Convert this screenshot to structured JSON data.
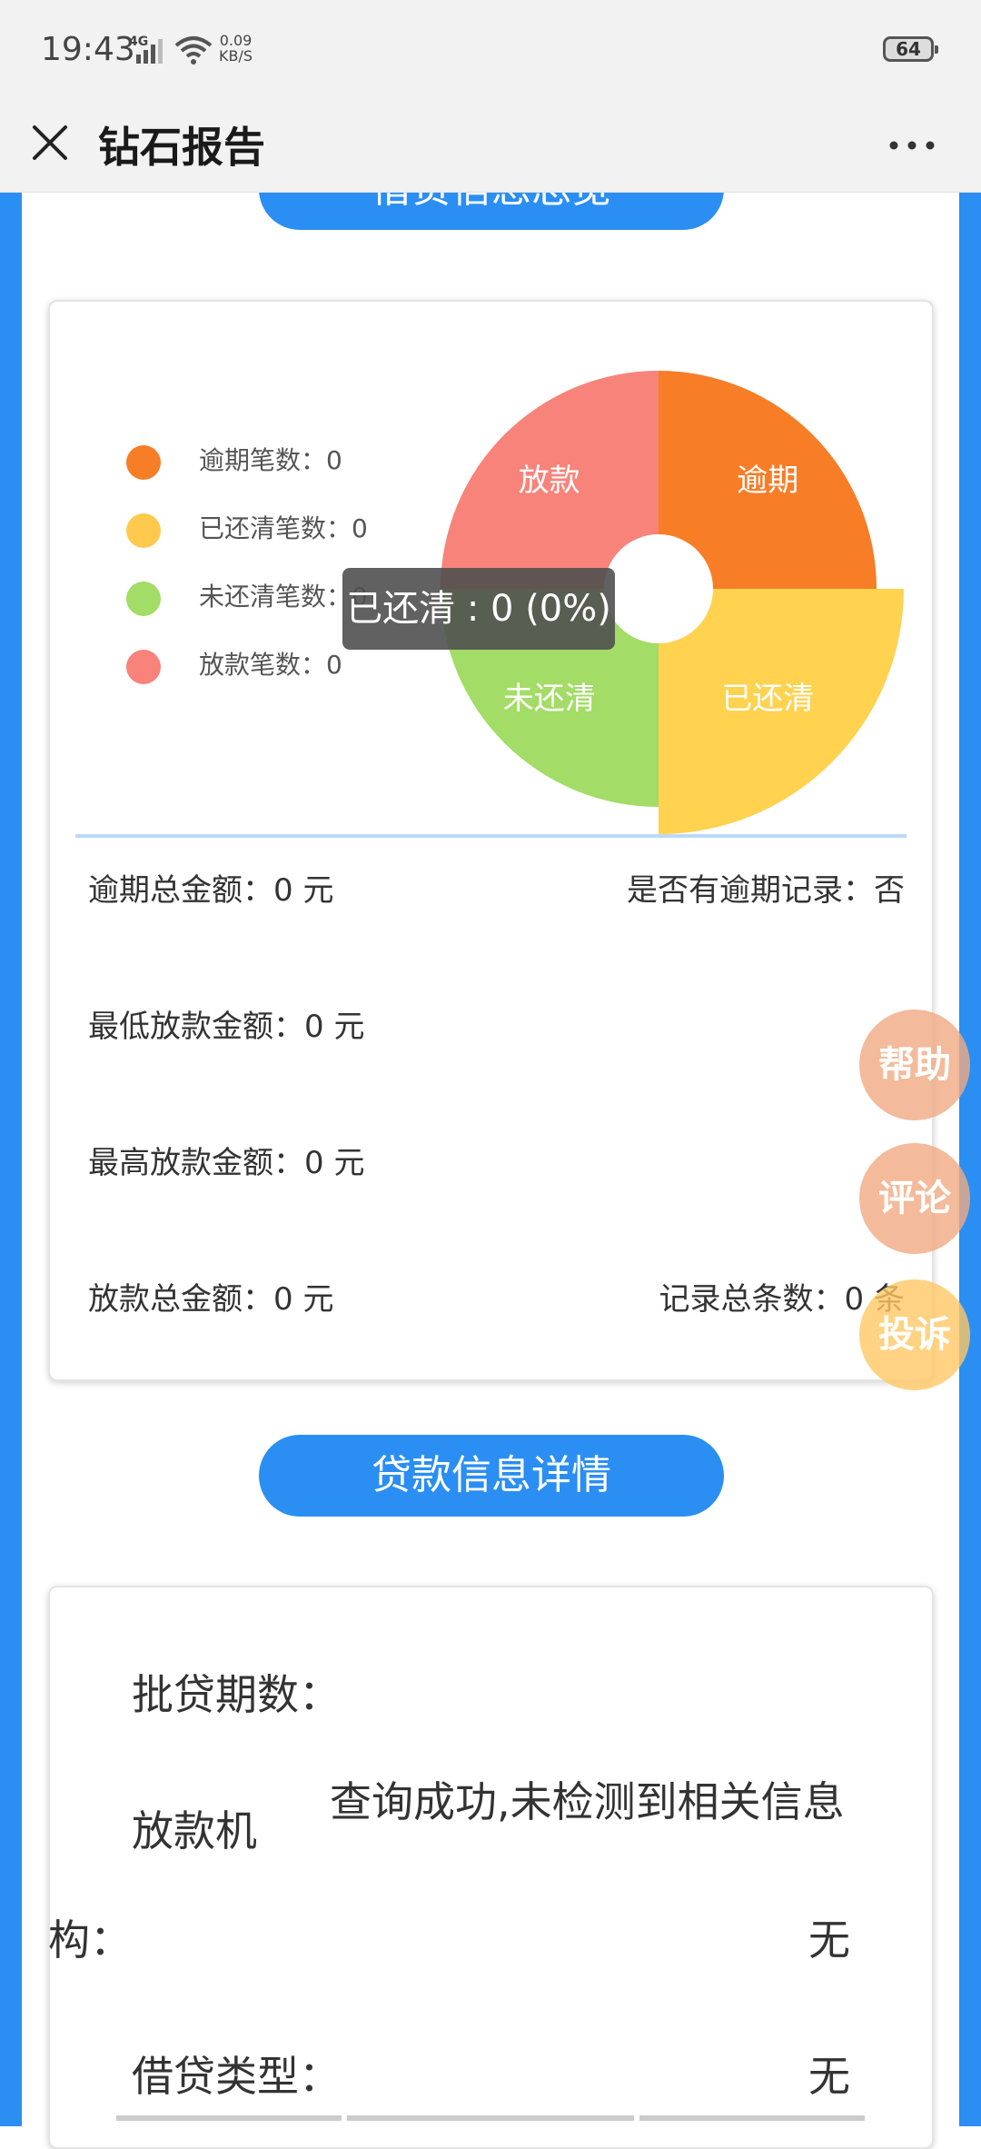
{
  "status_bar": {
    "time": "19:43",
    "network": "4G",
    "speed_value": "0.09",
    "speed_unit": "KB/S",
    "battery": "64"
  },
  "nav": {
    "title": "钻石报告"
  },
  "section1": {
    "title": "借贷信息总览"
  },
  "legend": [
    {
      "label": "逾期笔数：0",
      "color": "#f77d27"
    },
    {
      "label": "已还清笔数：0",
      "color": "#ffc94d"
    },
    {
      "label": "未还清笔数：0",
      "color": "#a3dc66"
    },
    {
      "label": "放款笔数：0",
      "color": "#f7837a"
    }
  ],
  "chart_data": {
    "type": "pie",
    "categories": [
      "逾期",
      "已还清",
      "未还清",
      "放款"
    ],
    "values": [
      0,
      0,
      0,
      0
    ],
    "colors": [
      "#f77d27",
      "#ffd250",
      "#a3dc66",
      "#f7837a"
    ],
    "highlighted": "已还清",
    "tooltip": "已还清 : 0 (0%)"
  },
  "stats": {
    "overdue_total": "逾期总金额：0  元",
    "has_overdue": "是否有逾期记录：否",
    "min_loan": "最低放款金额：0  元",
    "max_loan": "最高放款金额：0  元",
    "loan_total": "放款总金额：0  元",
    "record_count": "记录总条数：0  条"
  },
  "float_buttons": {
    "help": "帮助",
    "comment": "评论",
    "complaint": "投诉"
  },
  "section2": {
    "title": "贷款信息详情"
  },
  "details": {
    "periods_label": "批贷期数：",
    "institution_label_a": "放款机",
    "institution_label_b": "构：",
    "result_text": "查询成功,未检测到相关信息",
    "institution_value": "无",
    "type_label": "借贷类型：",
    "type_value": "无"
  }
}
